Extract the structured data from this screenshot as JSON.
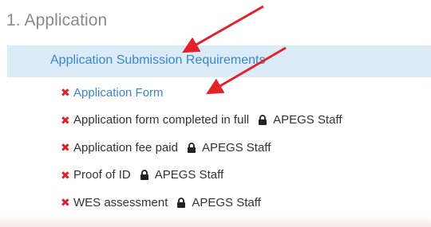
{
  "section": {
    "title": "1. Application"
  },
  "group": {
    "label": "Application Submission Requirements"
  },
  "requirements": [
    {
      "label": "Application Form",
      "is_link": true,
      "status_icon": "x-mark-icon",
      "access": ""
    },
    {
      "label": "Application form completed in full",
      "is_link": false,
      "status_icon": "x-mark-icon",
      "access": "APEGS Staff"
    },
    {
      "label": "Application fee paid",
      "is_link": false,
      "status_icon": "x-mark-icon",
      "access": "APEGS Staff"
    },
    {
      "label": "Proof of ID",
      "is_link": false,
      "status_icon": "x-mark-icon",
      "access": "APEGS Staff"
    },
    {
      "label": "WES assessment",
      "is_link": false,
      "status_icon": "x-mark-icon",
      "access": "APEGS Staff"
    }
  ],
  "icons": {
    "status": "x-mark-icon",
    "access": "lock-icon",
    "annotation": "red-arrow-icon"
  },
  "colors": {
    "link": "#3a86cf",
    "header_bg": "#dcebf8",
    "status_x": "#d8232a",
    "arrow": "#e3222a",
    "title": "#8a8a8a",
    "text": "#333333"
  }
}
